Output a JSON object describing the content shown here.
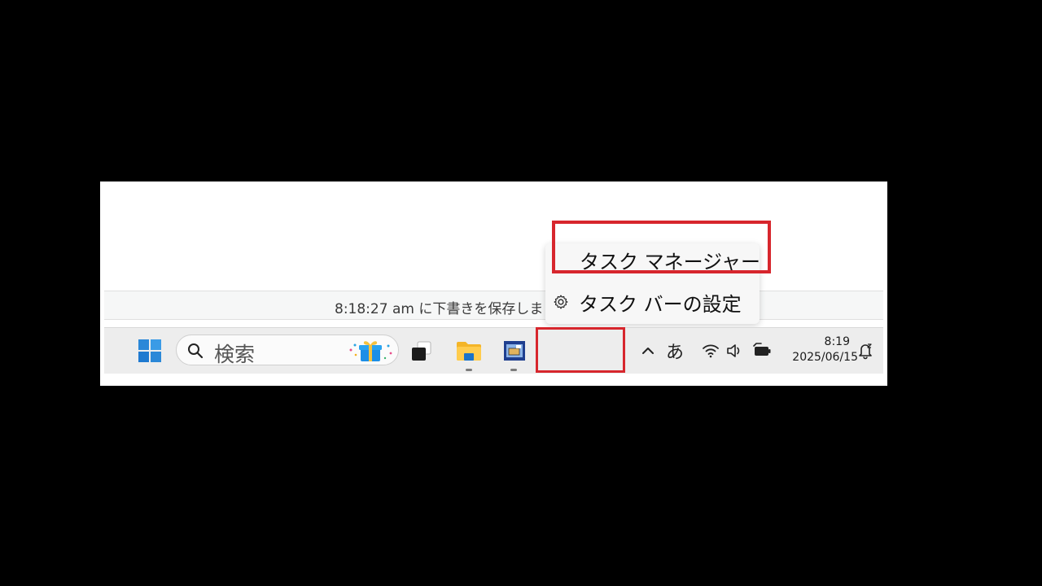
{
  "status_bar": {
    "save_status": "8:18:27 am に下書きを保存しま"
  },
  "context_menu": {
    "items": [
      {
        "label": "タスク マネージャー",
        "icon": "none"
      },
      {
        "label": "タスク バーの設定",
        "icon": "gear-icon"
      }
    ]
  },
  "taskbar": {
    "search_placeholder": "検索",
    "ime_indicator": "あ",
    "clock_time": "8:19",
    "clock_date": "2025/06/15",
    "icons": [
      "windows-start-icon",
      "search-icon",
      "gift-icon",
      "task-view-icon",
      "file-explorer-icon",
      "image-viewer-icon",
      "chevron-up-icon",
      "wifi-icon",
      "speaker-icon",
      "battery-icon",
      "notification-bell-icon"
    ]
  },
  "colors": {
    "highlight": "#d7262d",
    "taskbar_bg": "#ededed",
    "windows_blue": "#2b88d8"
  }
}
